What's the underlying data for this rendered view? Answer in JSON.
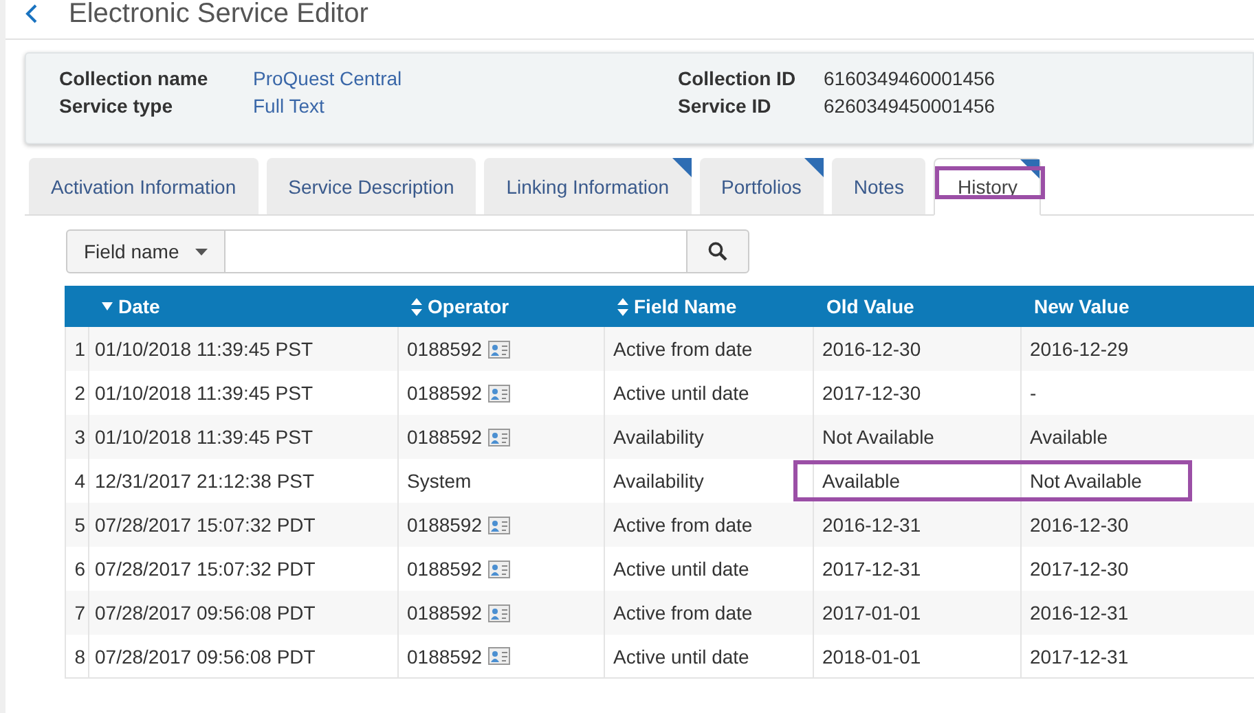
{
  "header": {
    "title": "Electronic Service Editor"
  },
  "summary": {
    "left": [
      {
        "label": "Collection name",
        "value": "ProQuest Central"
      },
      {
        "label": "Service type",
        "value": "Full Text"
      }
    ],
    "right": [
      {
        "label": "Collection ID",
        "value": "6160349460001456"
      },
      {
        "label": "Service ID",
        "value": "6260349450001456"
      }
    ]
  },
  "tabs": [
    {
      "label": "Activation Information",
      "selected": false,
      "flagged": false,
      "highlighted": false
    },
    {
      "label": "Service Description",
      "selected": false,
      "flagged": false,
      "highlighted": false
    },
    {
      "label": "Linking Information",
      "selected": false,
      "flagged": true,
      "highlighted": false
    },
    {
      "label": "Portfolios",
      "selected": false,
      "flagged": true,
      "highlighted": false
    },
    {
      "label": "Notes",
      "selected": false,
      "flagged": false,
      "highlighted": false
    },
    {
      "label": "History",
      "selected": true,
      "flagged": true,
      "highlighted": true
    }
  ],
  "search": {
    "scope": "Field name"
  },
  "table": {
    "columns": [
      {
        "label": "Date",
        "kind": "sorted"
      },
      {
        "label": "Operator",
        "kind": "sortable"
      },
      {
        "label": "Field Name",
        "kind": "sortable"
      },
      {
        "label": "Old Value",
        "kind": "plain"
      },
      {
        "label": "New Value",
        "kind": "plain"
      }
    ],
    "rows": [
      {
        "index": "1",
        "date": "01/10/2018 11:39:45 PST",
        "operator": "0188592",
        "operator_card": true,
        "field": "Active from date",
        "old": "2016-12-30",
        "new": "2016-12-29",
        "highlighted": false
      },
      {
        "index": "2",
        "date": "01/10/2018 11:39:45 PST",
        "operator": "0188592",
        "operator_card": true,
        "field": "Active until date",
        "old": "2017-12-30",
        "new": "-",
        "highlighted": false
      },
      {
        "index": "3",
        "date": "01/10/2018 11:39:45 PST",
        "operator": "0188592",
        "operator_card": true,
        "field": "Availability",
        "old": "Not Available",
        "new": "Available",
        "highlighted": false
      },
      {
        "index": "4",
        "date": "12/31/2017 21:12:38 PST",
        "operator": "System",
        "operator_card": false,
        "field": "Availability",
        "old": "Available",
        "new": "Not Available",
        "highlighted": true
      },
      {
        "index": "5",
        "date": "07/28/2017 15:07:32 PDT",
        "operator": "0188592",
        "operator_card": true,
        "field": "Active from date",
        "old": "2016-12-31",
        "new": "2016-12-30",
        "highlighted": false
      },
      {
        "index": "6",
        "date": "07/28/2017 15:07:32 PDT",
        "operator": "0188592",
        "operator_card": true,
        "field": "Active until date",
        "old": "2017-12-31",
        "new": "2017-12-30",
        "highlighted": false
      },
      {
        "index": "7",
        "date": "07/28/2017 09:56:08 PDT",
        "operator": "0188592",
        "operator_card": true,
        "field": "Active from date",
        "old": "2017-01-01",
        "new": "2016-12-31",
        "highlighted": false
      },
      {
        "index": "8",
        "date": "07/28/2017 09:56:08 PDT",
        "operator": "0188592",
        "operator_card": true,
        "field": "Active until date",
        "old": "2018-01-01",
        "new": "2017-12-31",
        "highlighted": false
      }
    ]
  }
}
